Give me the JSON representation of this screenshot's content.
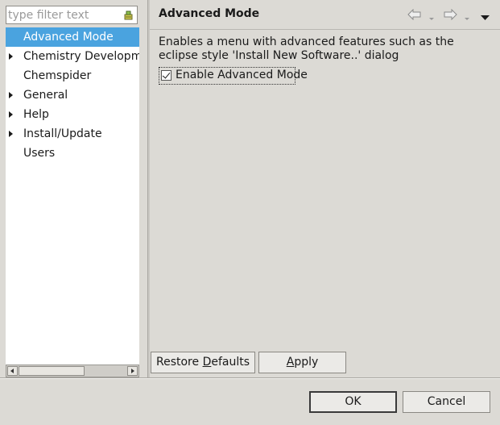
{
  "filter": {
    "placeholder": "type filter text"
  },
  "tree": {
    "items": [
      {
        "label": "Advanced Mode",
        "expandable": false,
        "selected": true
      },
      {
        "label": "Chemistry Developm",
        "expandable": true,
        "selected": false
      },
      {
        "label": "Chemspider",
        "expandable": false,
        "selected": false
      },
      {
        "label": "General",
        "expandable": true,
        "selected": false
      },
      {
        "label": "Help",
        "expandable": true,
        "selected": false
      },
      {
        "label": "Install/Update",
        "expandable": true,
        "selected": false
      },
      {
        "label": "Users",
        "expandable": false,
        "selected": false
      }
    ]
  },
  "page": {
    "title": "Advanced Mode",
    "description": "Enables a menu with advanced features such as the eclipse style 'Install New Software..' dialog",
    "checkbox": {
      "label": "Enable Advanced Mode",
      "checked": true
    }
  },
  "buttons": {
    "restore_defaults_pre": "Restore ",
    "restore_defaults_mnemonic": "D",
    "restore_defaults_post": "efaults",
    "apply_mnemonic": "A",
    "apply_post": "pply",
    "ok": "OK",
    "cancel": "Cancel"
  },
  "icons": {
    "back": "back-arrow-icon",
    "forward": "forward-arrow-icon",
    "menu": "view-menu-icon",
    "clear_filter": "clear-filter-icon"
  },
  "colors": {
    "selection": "#4aa3df",
    "background": "#dcdad5"
  }
}
